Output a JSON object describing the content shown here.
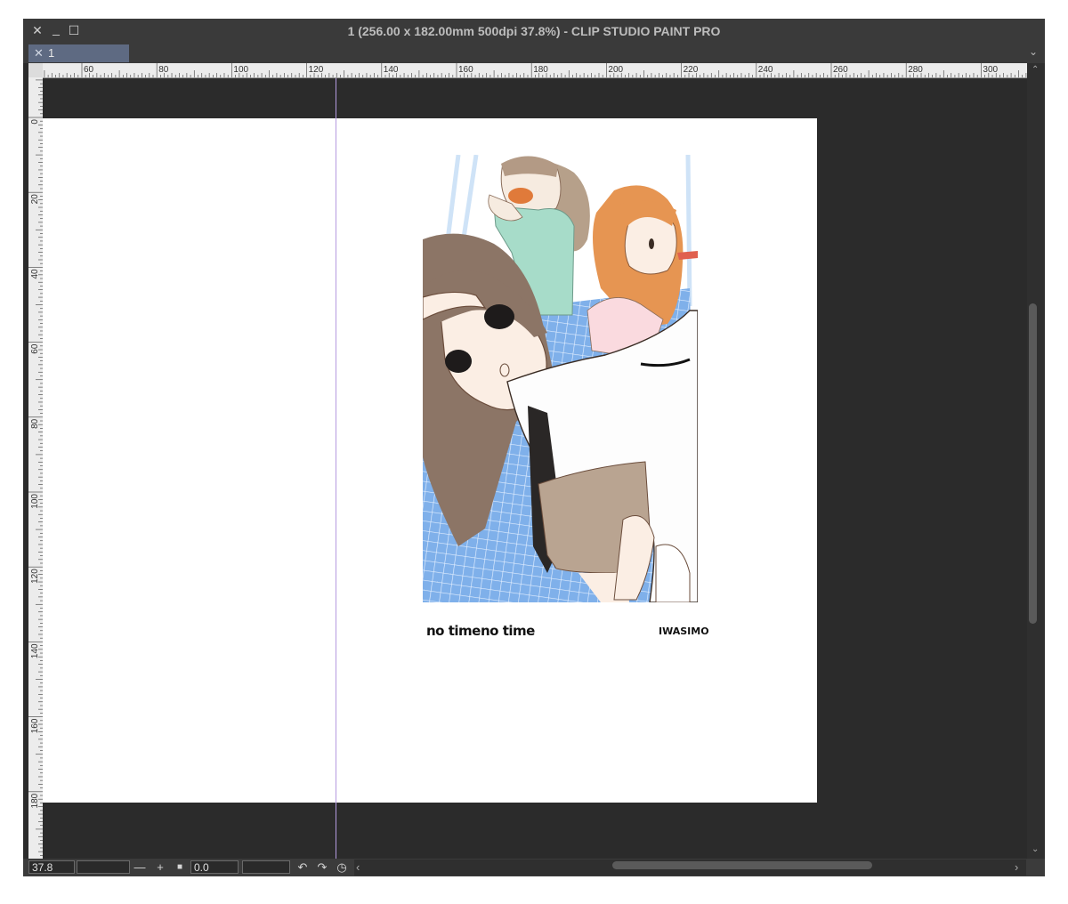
{
  "window": {
    "title": "1 (256.00 x 182.00mm 500dpi 37.8%)  - CLIP STUDIO PAINT PRO",
    "controls": {
      "close": "✕",
      "minimize": "_",
      "maximize": "☐"
    }
  },
  "tabs": [
    {
      "label": "1",
      "close": "✕"
    }
  ],
  "tab_overflow": "⌄",
  "ruler": {
    "horizontal_labels": [
      "60",
      "80",
      "100",
      "120",
      "140",
      "160",
      "180",
      "200",
      "220",
      "240",
      "260",
      "280",
      "300"
    ],
    "vertical_labels": [
      "0",
      "20",
      "40",
      "60",
      "80",
      "100",
      "120",
      "140",
      "160",
      "180"
    ]
  },
  "canvas": {
    "caption_left": "no time",
    "caption_right": "no time",
    "author": "IWASIMO"
  },
  "statusbar": {
    "zoom": "37.8",
    "zoom_out": "—",
    "zoom_in": "+",
    "fit": "■",
    "rotation": "0.0",
    "rotate_left": "↶",
    "rotate_right": "↷",
    "reset_rotation": "◷",
    "scroll_left": "‹",
    "scroll_right": "›"
  },
  "colors": {
    "paper": "#ffffff",
    "workspace": "#2b2b2b",
    "guide": "#b59be0",
    "tab_active": "#5e6a82",
    "floor_blue": "#7fb0ea",
    "shirt_white": "#fdfdfd",
    "skirt": "#b9a491",
    "hair_brown": "#8c7566",
    "hair_orange": "#e69552",
    "sweater": "#a7dcc9"
  }
}
